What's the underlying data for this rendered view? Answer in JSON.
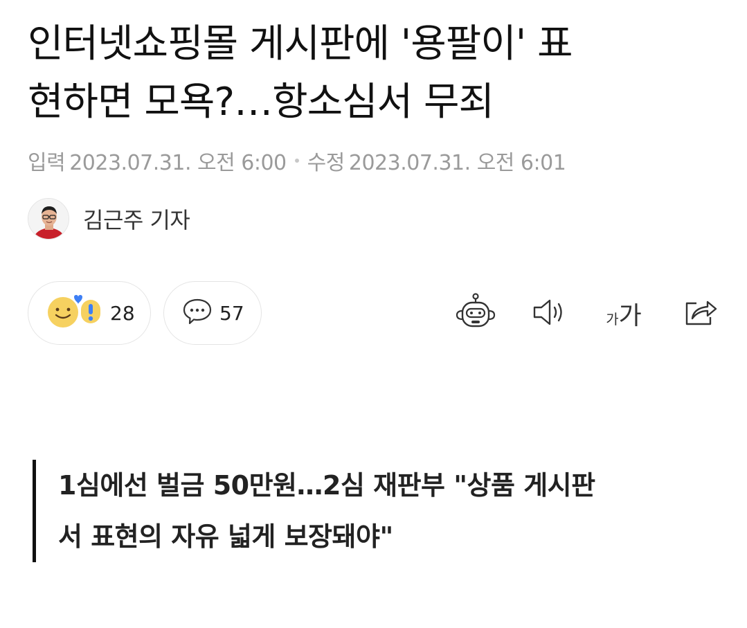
{
  "article": {
    "headline_line1": "인터넷쇼핑몰 게시판에 '용팔이' 표",
    "headline_line2": "현하면 모욕?…항소심서 무죄",
    "published_label": "입력",
    "published_value": "2023.07.31. 오전 6:00",
    "modified_label": "수정",
    "modified_value": "2023.07.31. 오전 6:01",
    "reporter": "김근주 기자",
    "subhead_line1": "1심에선 벌금 50만원…2심 재판부 \"상품 게시판",
    "subhead_line2": "서 표현의 자유 넓게 보장돼야\""
  },
  "actions": {
    "reaction_count": "28",
    "comment_count": "57",
    "font_small": "가",
    "font_large": "가"
  },
  "icons": {
    "reaction": "emoji-reaction-icon",
    "comment": "speech-bubble-icon",
    "summary_bot": "robot-icon",
    "read_aloud": "speaker-icon",
    "font_size": "font-size-icon",
    "share": "share-icon"
  },
  "colors": {
    "text": "#111111",
    "meta": "#9a9a9a",
    "border": "#e4e4e4",
    "emoji_yellow": "#f6d160",
    "emoji_blue": "#3d7ff5"
  }
}
